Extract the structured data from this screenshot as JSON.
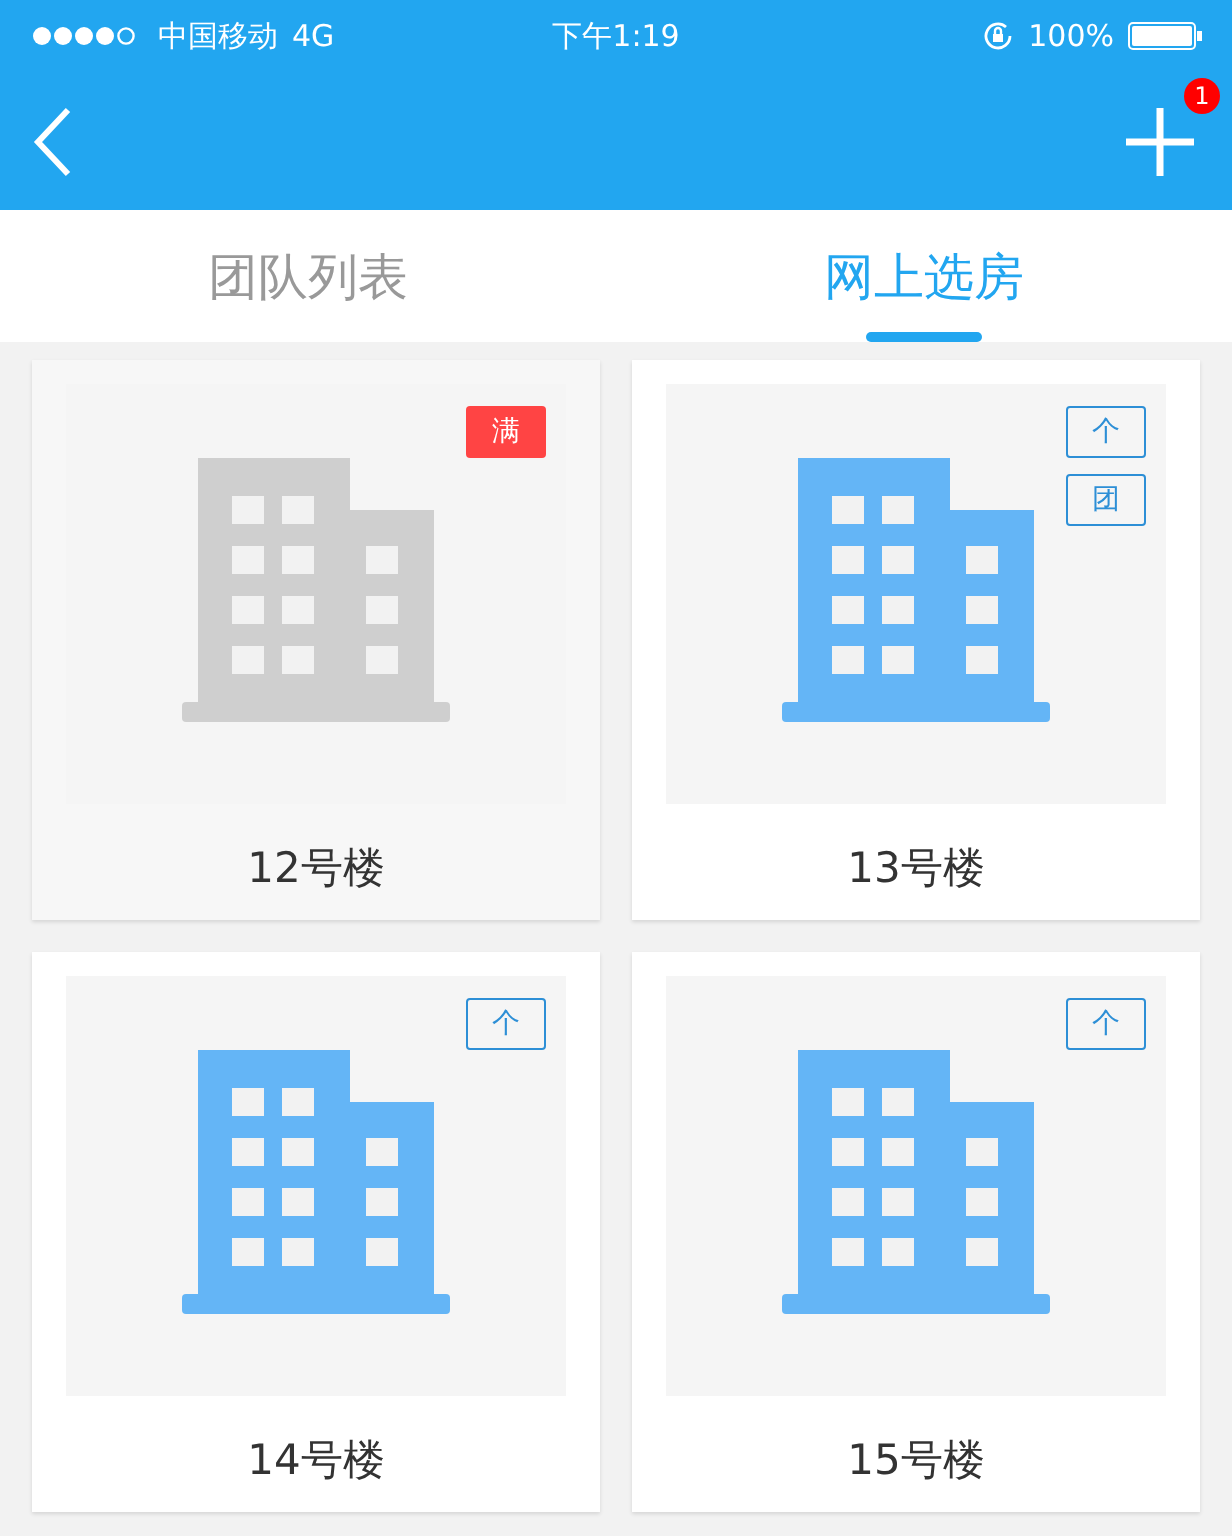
{
  "status_bar": {
    "carrier": "中国移动",
    "network": "4G",
    "time": "下午1:19",
    "battery": "100%"
  },
  "nav": {
    "badge": "1"
  },
  "tabs": [
    {
      "label": "团队列表",
      "selected": false
    },
    {
      "label": "网上选房",
      "selected": true
    }
  ],
  "buildings": [
    {
      "name": "12号楼",
      "full": true,
      "tags": [
        "满"
      ]
    },
    {
      "name": "13号楼",
      "full": false,
      "tags": [
        "个",
        "团"
      ]
    },
    {
      "name": "14号楼",
      "full": false,
      "tags": [
        "个"
      ]
    },
    {
      "name": "15号楼",
      "full": false,
      "tags": [
        "个"
      ]
    }
  ]
}
